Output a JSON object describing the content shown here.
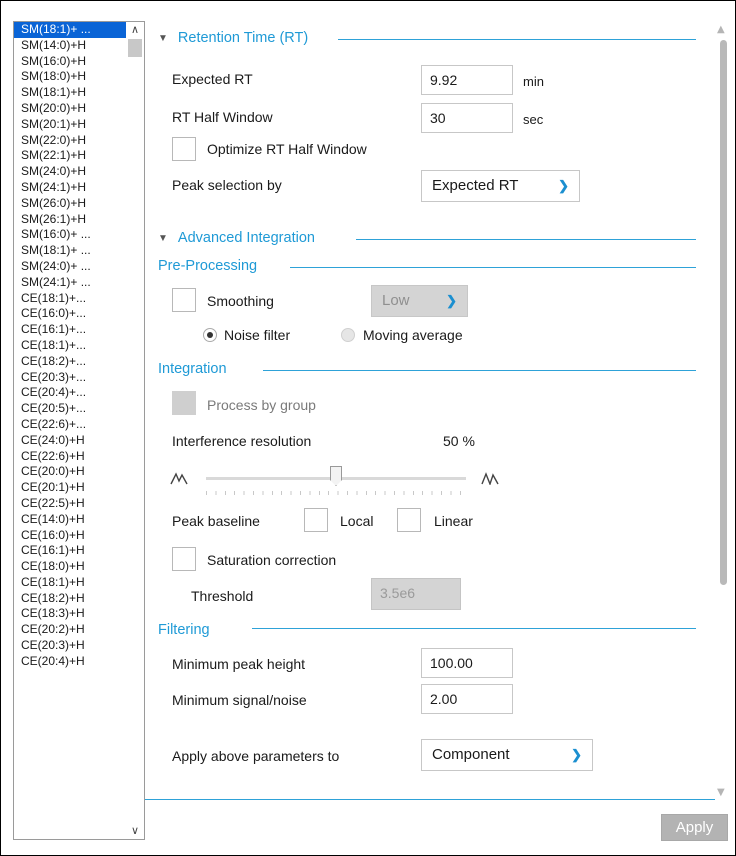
{
  "list": {
    "items": [
      "SM(18:1)+ ...",
      "SM(14:0)+H",
      "SM(16:0)+H",
      "SM(18:0)+H",
      "SM(18:1)+H",
      "SM(20:0)+H",
      "SM(20:1)+H",
      "SM(22:0)+H",
      "SM(22:1)+H",
      "SM(24:0)+H",
      "SM(24:1)+H",
      "SM(26:0)+H",
      "SM(26:1)+H",
      "SM(16:0)+ ...",
      "SM(18:1)+ ...",
      "SM(24:0)+ ...",
      "SM(24:1)+ ...",
      "CE(18:1)+...",
      "CE(16:0)+...",
      "CE(16:1)+...",
      "CE(18:1)+...",
      "CE(18:2)+...",
      "CE(20:3)+...",
      "CE(20:4)+...",
      "CE(20:5)+...",
      "CE(22:6)+...",
      "CE(24:0)+H",
      "CE(22:6)+H",
      "CE(20:0)+H",
      "CE(20:1)+H",
      "CE(22:5)+H",
      "CE(14:0)+H",
      "CE(16:0)+H",
      "CE(16:1)+H",
      "CE(18:0)+H",
      "CE(18:1)+H",
      "CE(18:2)+H",
      "CE(18:3)+H",
      "CE(20:2)+H",
      "CE(20:3)+H",
      "CE(20:4)+H"
    ],
    "selected_index": 0
  },
  "rt": {
    "title": "Retention Time (RT)",
    "expected_label": "Expected RT",
    "expected_value": "9.92",
    "expected_unit": "min",
    "half_label": "RT Half Window",
    "half_value": "30",
    "half_unit": "sec",
    "optimize_label": "Optimize RT Half Window",
    "peak_sel_label": "Peak selection by",
    "peak_sel_value": "Expected RT"
  },
  "adv": {
    "title": "Advanced Integration"
  },
  "pre": {
    "title": "Pre-Processing",
    "smoothing_label": "Smoothing",
    "smoothing_level": "Low",
    "noise_label": "Noise filter",
    "moving_label": "Moving average"
  },
  "integ": {
    "title": "Integration",
    "group_label": "Process by group",
    "interf_label": "Interference resolution",
    "interf_value": "50 %",
    "interf_fraction": 0.5,
    "baseline_label": "Peak baseline",
    "local_label": "Local",
    "linear_label": "Linear",
    "sat_label": "Saturation correction",
    "thresh_label": "Threshold",
    "thresh_value": "3.5e6"
  },
  "filter": {
    "title": "Filtering",
    "minh_label": "Minimum peak height",
    "minh_value": "100.00",
    "minsn_label": "Minimum signal/noise",
    "minsn_value": "2.00",
    "apply_to_label": "Apply above parameters to",
    "apply_to_value": "Component"
  },
  "footer": {
    "apply_label": "Apply"
  },
  "colors": {
    "accent": "#1f9ad6",
    "selection": "#0a64d6"
  }
}
